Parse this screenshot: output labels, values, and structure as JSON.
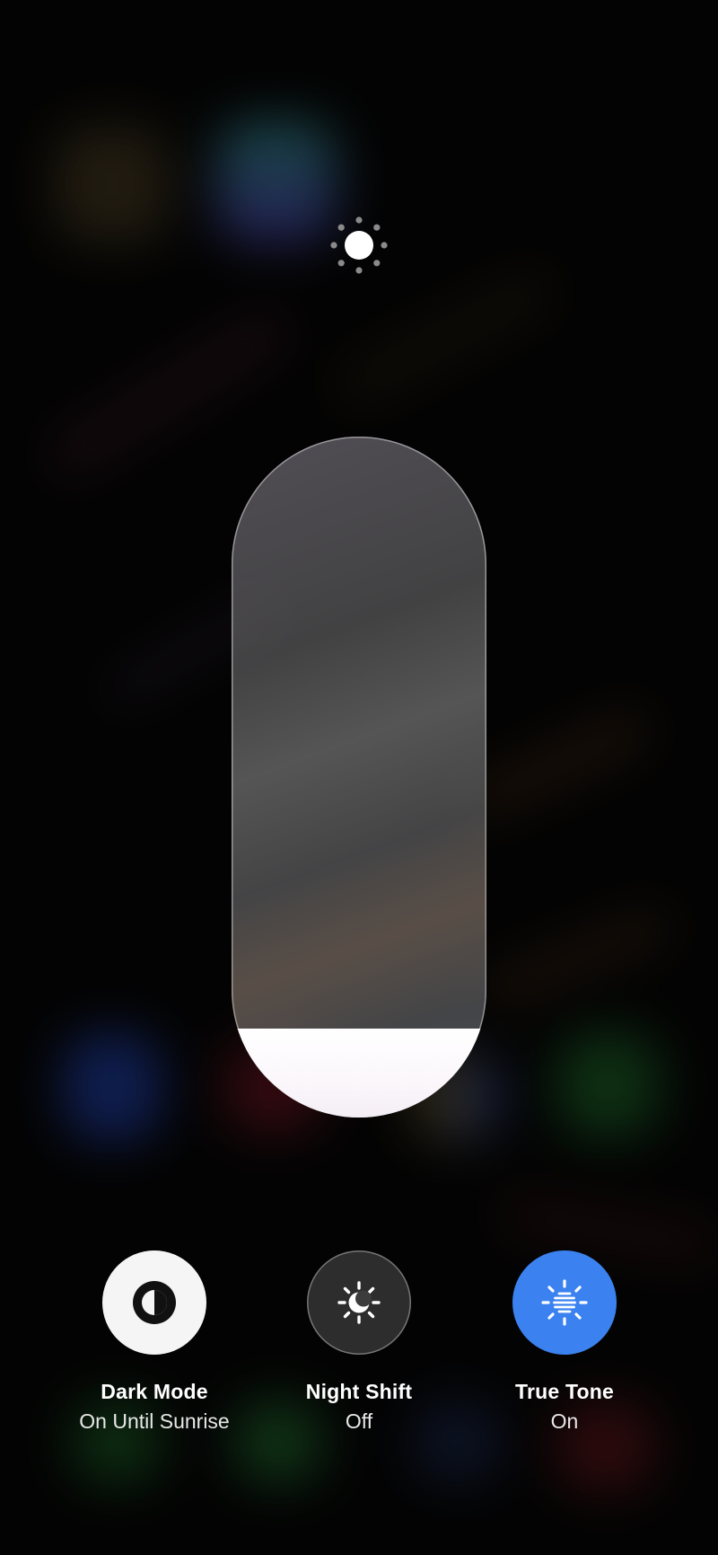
{
  "brightness": {
    "level": 0.13
  },
  "colors": {
    "dark_mode_button": "#f5f5f5",
    "true_tone_button": "#3b82f0",
    "slider_fill": "#ffffff"
  },
  "icons": {
    "top": "sun-icon",
    "dark_mode": "half-circle-icon",
    "night_shift": "sun-moon-icon",
    "true_tone": "sun-lines-icon"
  },
  "controls": [
    {
      "title": "Dark Mode",
      "status": "On Until Sunrise"
    },
    {
      "title": "Night Shift",
      "status": "Off"
    },
    {
      "title": "True Tone",
      "status": "On"
    }
  ]
}
